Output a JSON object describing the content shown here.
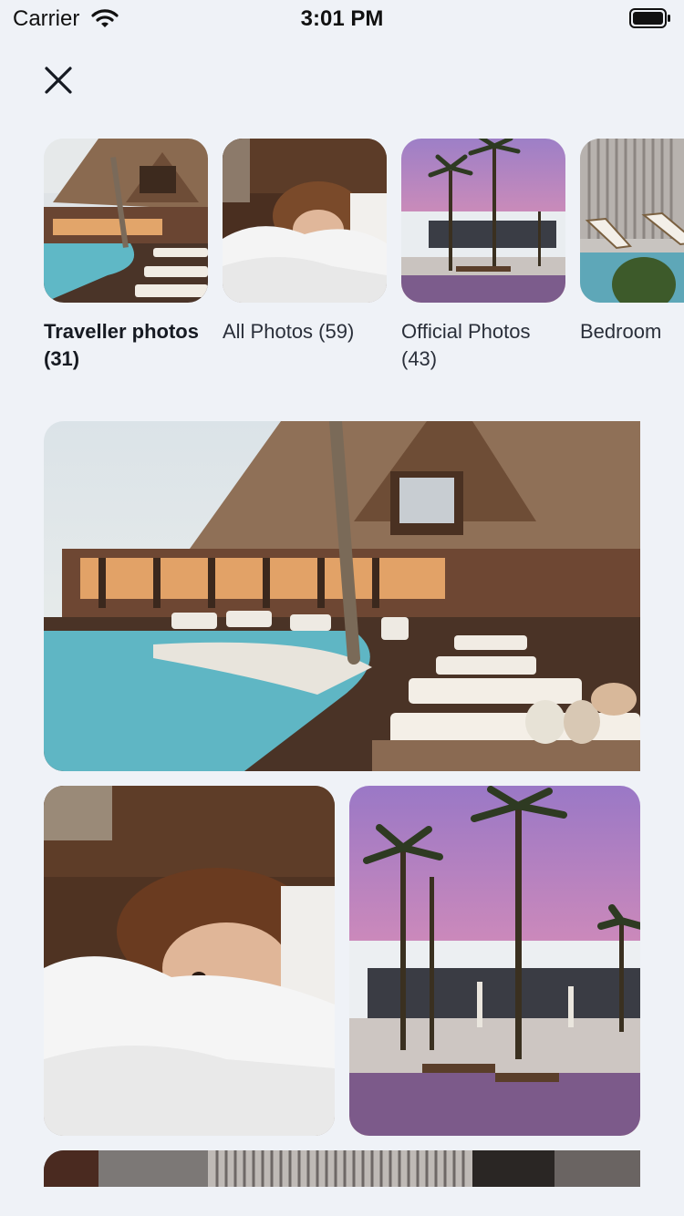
{
  "status_bar": {
    "carrier": "Carrier",
    "time": "3:01 PM"
  },
  "albums": [
    {
      "label": "Traveller photos (31)",
      "active": true,
      "image": "resort-pool"
    },
    {
      "label": "All Photos (59)",
      "active": false,
      "image": "woman-in-bed"
    },
    {
      "label": "Official Photos (43)",
      "active": false,
      "image": "palms-sunset"
    },
    {
      "label": "Bedroom",
      "active": false,
      "image": "beach-chairs"
    }
  ],
  "grid_photos": [
    "resort-pool",
    "woman-in-bed",
    "palms-sunset",
    "interior-slats"
  ]
}
